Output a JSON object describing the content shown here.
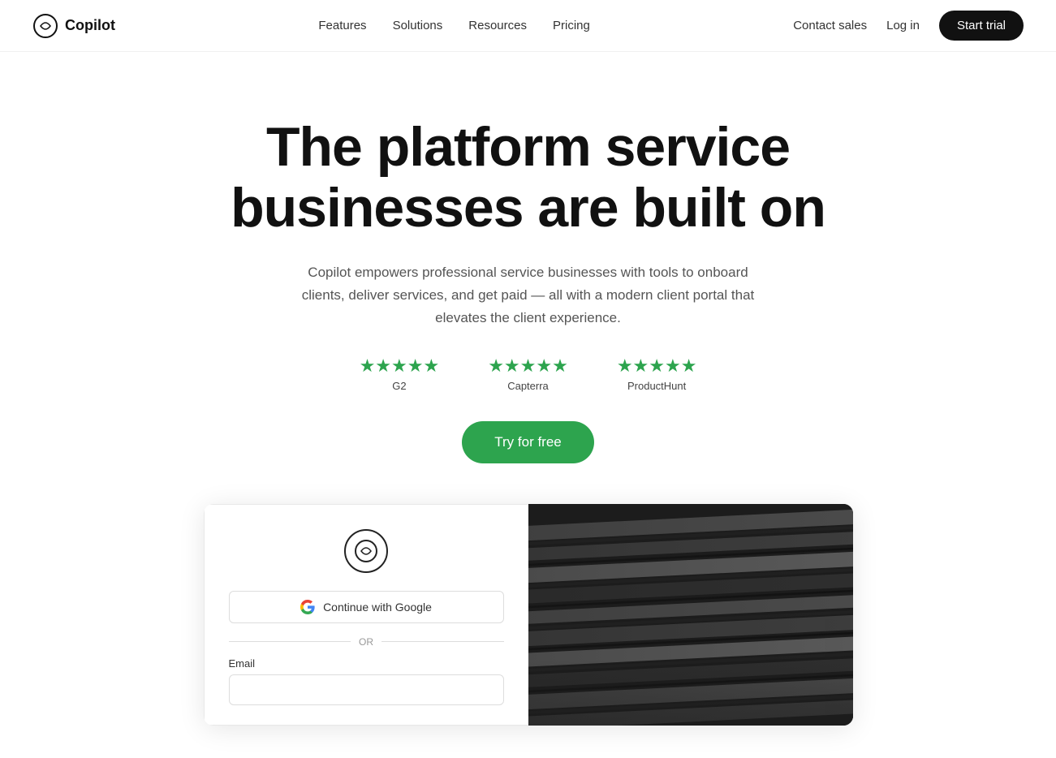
{
  "nav": {
    "logo_text": "Copilot",
    "links": [
      {
        "label": "Features",
        "href": "#"
      },
      {
        "label": "Solutions",
        "href": "#"
      },
      {
        "label": "Resources",
        "href": "#"
      },
      {
        "label": "Pricing",
        "href": "#"
      }
    ],
    "contact_sales": "Contact sales",
    "login": "Log in",
    "start_trial": "Start trial"
  },
  "hero": {
    "heading_line1": "The platform service",
    "heading_line2": "businesses are built on",
    "description": "Copilot empowers professional service businesses with tools to onboard clients, deliver services, and get paid — all with a modern client portal that elevates the client experience.",
    "cta_label": "Try for free"
  },
  "ratings": [
    {
      "stars": 5,
      "label": "G2"
    },
    {
      "stars": 5,
      "label": "Capterra"
    },
    {
      "stars": 5,
      "label": "ProductHunt"
    }
  ],
  "signup": {
    "google_button": "Continue with Google",
    "divider": "OR",
    "email_label": "Email",
    "email_placeholder": ""
  },
  "colors": {
    "green": "#2da44e",
    "dark": "#111111"
  }
}
